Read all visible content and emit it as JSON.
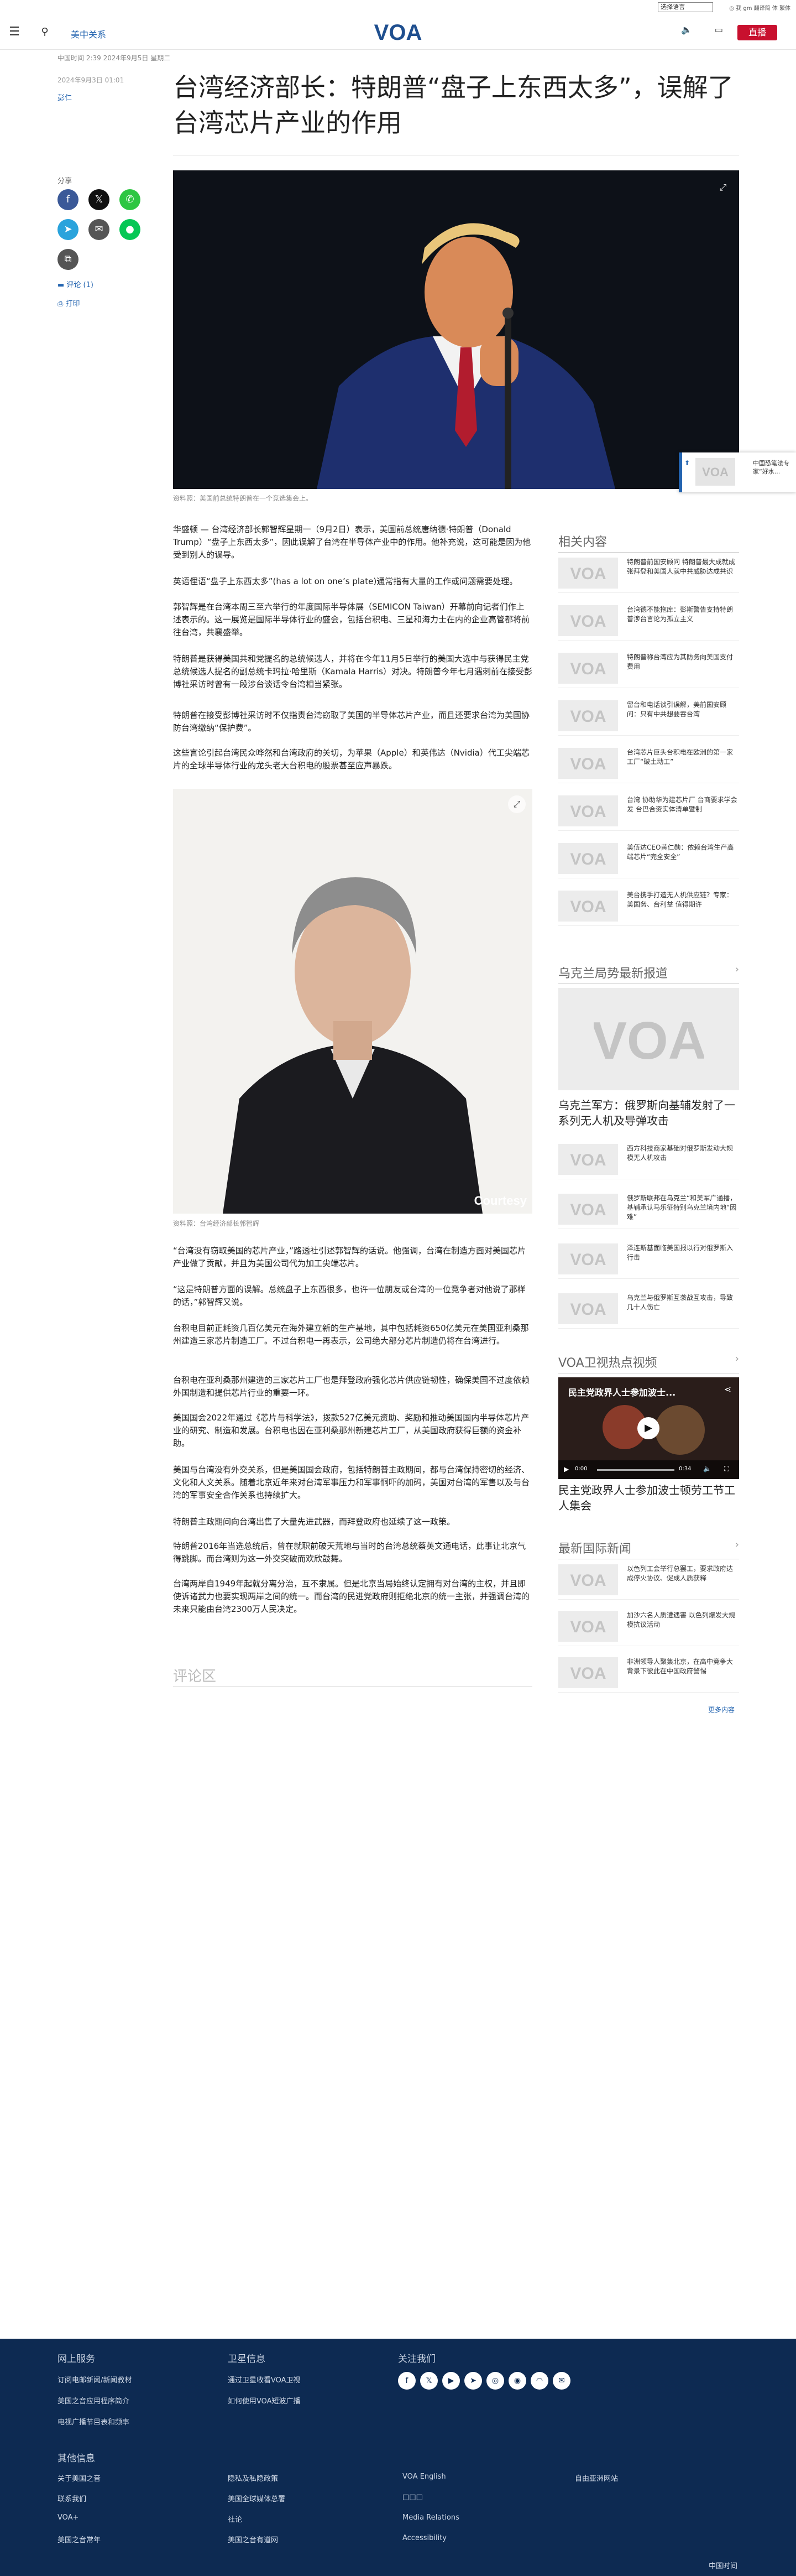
{
  "util": {
    "language_select": "选择语言",
    "links": "◎ 我 gm 翻译简 体 繁体"
  },
  "header": {
    "section": "美中关系",
    "live": "直播"
  },
  "article": {
    "meta_top": "中国时间 2:39 2024年9月5日 星期二",
    "date": "2024年9月3日 01:01",
    "author": "彭仁",
    "title": "台湾经济部长：特朗普“盘子上东西太多”，误解了台湾芯片产业的作用",
    "share_label": "分享",
    "comments": "评论 (1)",
    "print": "打印",
    "hero_caption": "资料照：美国前总统特朗普在一个竞选集会上。",
    "paragraphs": [
      "华盛顿 — 台湾经济部长郭智辉星期一（9月2日）表示，美国前总统唐纳德·特朗普（Donald Trump）“盘子上东西太多”，因此误解了台湾在半导体产业中的作用。他补充说，这可能是因为他受到别人的误导。",
      "英语俚语“盘子上东西太多”(has a lot on one’s plate)通常指有大量的工作或问题需要处理。",
      "郭智辉是在台湾本周三至六举行的年度国际半导体展（SEMICON Taiwan）开幕前向记者们作上述表示的。这一展览是国际半导体行业的盛会，包括台积电、三星和海力士在内的企业高管都将前往台湾，共襄盛举。",
      "特朗普是获得美国共和党提名的总统候选人，并将在今年11月5日举行的美国大选中与获得民主党总统候选人提名的副总统卡玛拉·哈里斯（Kamala Harris）对决。特朗普今年七月遇刺前在接受彭博社采访时曾有一段涉台谈话令台湾相当紧张。",
      "特朗普在接受彭博社采访时不仅指责台湾窃取了美国的半导体芯片产业，而且还要求台湾为美国协防台湾缴纳“保护费”。",
      "这些言论引起台湾民众哗然和台湾政府的关切，为苹果（Apple）和英伟达（Nvidia）代工尖端芯片的全球半导体行业的龙头老大台积电的股票甚至应声暴跌。",
      "“台湾没有窃取美国的芯片产业，”路透社引述郭智辉的话说。他强调，台湾在制造方面对美国芯片产业做了贡献，并且为美国公司代为加工尖端芯片。",
      "“这是特朗普方面的误解。总统盘子上东西很多，也许一位朋友或台湾的一位竞争者对他说了那样的话，”郭智辉又说。",
      "台积电目前正耗资几百亿美元在海外建立新的生产基地，其中包括耗资650亿美元在美国亚利桑那州建造三家芯片制造工厂。不过台积电一再表示，公司绝大部分芯片制造仍将在台湾进行。",
      "台积电在亚利桑那州建造的三家芯片工厂也是拜登政府强化芯片供应链韧性，确保美国不过度依赖外国制造和提供芯片行业的重要一环。",
      "美国国会2022年通过《芯片与科学法》，拨款527亿美元资助、奖励和推动美国国内半导体芯片产业的研究、制造和发展。台积电也因在亚利桑那州新建芯片工厂，从美国政府获得巨额的资金补助。",
      "美国与台湾没有外交关系，但是美国国会政府，包括特朗普主政期间，都与台湾保持密切的经济、文化和人文关系。随着北京近年来对台湾军事压力和军事恫吓的加码，美国对台湾的军售以及与台湾的军事安全合作关系也持续扩大。",
      "特朗普主政期间向台湾出售了大量先进武器，而拜登政府也延续了这一政策。",
      "特朗普2016年当选总统后，曾在就职前破天荒地与当时的台湾总统蔡英文通电话，此事让北京气得跳脚。而台湾则为这一外交突破而欢欣鼓舞。",
      "台湾两岸自1949年起就分离分治，互不隶属。但是北京当局始终认定拥有对台湾的主权，并且即使诉诸武力也要实现两岸之间的统一。而台湾的民进党政府则拒绝北京的统一主张，并强调台湾的未来只能由台湾2300万人民决定。"
    ],
    "img2_credit": "Courtesy",
    "img2_caption": "资料照：台湾经济部长郭智辉",
    "comments_header": "评论区"
  },
  "sidebar": {
    "related_header": "相关内容",
    "related": [
      "特朗普前国安顾问 特朗普最大成就成张拜登和美国人就中共威胁达成共识",
      "台湾德不能拖库：彭斯警告支持特朗普涉台言论为孤立主义",
      "特朗普称台湾应为其防务向美国支付费用",
      "留台和电话谈引误解，美前国安顾问：只有中共想要吞台湾",
      "台湾芯片巨头台积电在欧洲的第一家工厂“破土动工”",
      "台湾 协助华为建芯片厂 台商要求学会发 台巴合资实体清单暨制",
      "美伍达CEO黄仁勋：依赖台湾生产高端芯片“完全安全”",
      "美台携手打造无人机供应链？专家：美国务、台利益 值得期许"
    ],
    "ukraine_header": "乌克兰局势最新报道",
    "ukraine_main": "乌克兰军方：俄罗斯向基辅发射了一系列无人机及导弹攻击",
    "ukraine": [
      "西方科技商家基础对俄罗斯发动大规模无人机攻击",
      "俄罗斯联邦在乌克兰“和美军广通播，基辅承认马乐征特别乌克兰境内地“因难”",
      "泽连斯基面临美国报以行对俄罗斯入行击",
      "乌克兰与俄罗斯互袭战互攻击，导致几十人伤亡"
    ],
    "video_header": "VOA卫视热点视频",
    "video_overlay": "民主党政界人士参加波士...",
    "video_time_cur": "0:00",
    "video_time_total": "0:34",
    "video_title": "民主党政界人士参加波士顿劳工节工人集会",
    "intl_header": "最新国际新闻",
    "intl": [
      "以色列工会举行总罢工，要求政府达成停火协议、促成人质获释",
      "加沙六名人质遭遇害 以色列爆发大规模抗议活动",
      "非洲领导人聚集北京，在高中竞争大背景下彼此在中国政府警惕"
    ],
    "more": "更多内容"
  },
  "float": {
    "text": "中国恐笔法专家“好水..."
  },
  "footer": {
    "col1_header": "网上服务",
    "col1": [
      "订阅电邮新闻/新闻教材",
      "美国之音应用程序简介",
      "电视广播节目表和频率"
    ],
    "col2_header": "卫星信息",
    "col2": [
      "通过卫星收看VOA卫视",
      "如何使用VOA短波广播"
    ],
    "col3_header": "关注我们",
    "social_icons": [
      "facebook-icon",
      "x-icon",
      "youtube-icon",
      "telegram-icon",
      "instagram-icon",
      "podcast-icon",
      "rss-icon",
      "email-icon"
    ],
    "other_header": "其他信息",
    "links": [
      [
        "关于美国之音",
        "隐私及私隐政策",
        "VOA English",
        "自由亚洲网站"
      ],
      [
        "联系我们",
        "美国全球媒体总署",
        "□□□",
        ""
      ],
      [
        "VOA+",
        "社论",
        "Media Relations",
        ""
      ],
      [
        "美国之音常年",
        "美国之音有道网",
        "Accessibility",
        ""
      ]
    ],
    "time": "中国时间"
  }
}
